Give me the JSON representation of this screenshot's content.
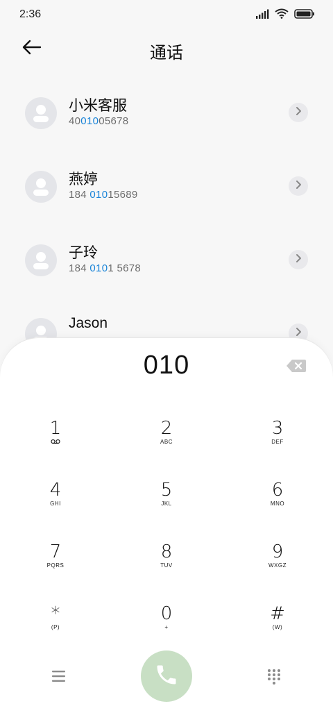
{
  "status_bar": {
    "time": "2:36"
  },
  "header": {
    "title": "通话"
  },
  "contacts": [
    {
      "name": "小米客服",
      "number": {
        "pre": "40",
        "match": "010",
        "post": "05678"
      }
    },
    {
      "name": "燕婷",
      "number": {
        "pre": "184 ",
        "match": "010",
        "post": "15689"
      }
    },
    {
      "name": "子玲",
      "number": {
        "pre": "184 ",
        "match": "010",
        "post": "1 5678"
      }
    },
    {
      "name": "Jason",
      "number": {
        "pre": "",
        "match": "",
        "post": ""
      }
    }
  ],
  "dialpad": {
    "input": "010",
    "keys": [
      {
        "digit": "1",
        "letters": ""
      },
      {
        "digit": "2",
        "letters": "ABC"
      },
      {
        "digit": "3",
        "letters": "DEF"
      },
      {
        "digit": "4",
        "letters": "GHI"
      },
      {
        "digit": "5",
        "letters": "JKL"
      },
      {
        "digit": "6",
        "letters": "MNO"
      },
      {
        "digit": "7",
        "letters": "PQRS"
      },
      {
        "digit": "8",
        "letters": "TUV"
      },
      {
        "digit": "9",
        "letters": "WXGZ"
      },
      {
        "digit": "*",
        "letters": "(P)"
      },
      {
        "digit": "0",
        "letters": "+"
      },
      {
        "digit": "#",
        "letters": "(W)"
      }
    ],
    "key1_icon": "voicemail-icon"
  },
  "icons": {
    "back": "back-arrow-icon",
    "chevron": "chevron-right-icon",
    "backspace": "backspace-icon",
    "menu": "menu-icon",
    "call": "phone-icon",
    "keypad": "keypad-icon"
  },
  "colors": {
    "highlight": "#1a84d8",
    "call_button": "#c8dfc4",
    "background": "#f7f7f7"
  }
}
